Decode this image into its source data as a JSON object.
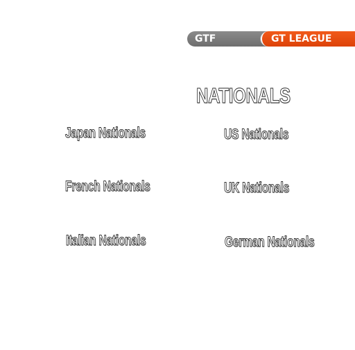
{
  "tabs": {
    "gtf_label": "GTF",
    "gt_league_label": "GT LEAGUE",
    "active": "GT LEAGUE"
  },
  "heading": "NATIONALS",
  "events": [
    {
      "label": "Japan Nationals"
    },
    {
      "label": "US Nationals"
    },
    {
      "label": "French Nationals"
    },
    {
      "label": "UK Nationals"
    },
    {
      "label": "Italian Nationals"
    },
    {
      "label": "German Nationals"
    }
  ],
  "colors": {
    "background": "#ffffff",
    "tab_inactive": "#7a7a7a",
    "tab_active": "#e84d10",
    "text_fill": "#ffffff",
    "text_outline": "#2a2a2a"
  }
}
